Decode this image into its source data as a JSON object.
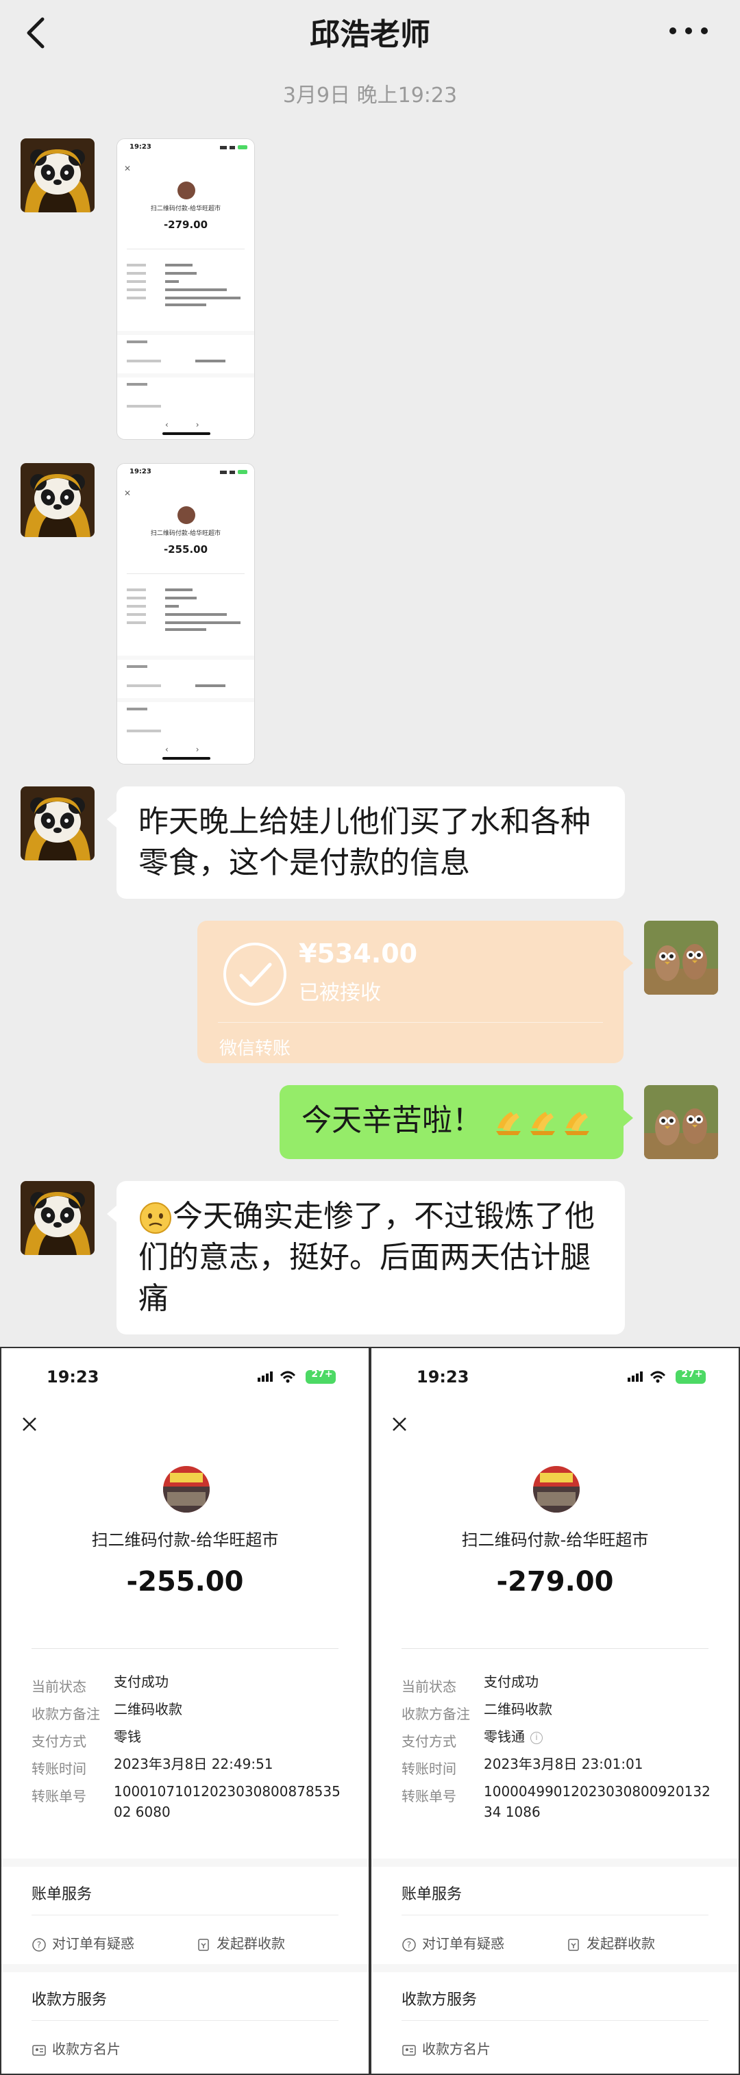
{
  "header": {
    "title": "邱浩老师"
  },
  "timestamp": "3月9日 晚上19:23",
  "messages": {
    "m1_text": "昨天晚上给娃儿他们买了水和各种零食，这个是付款的信息",
    "transfer": {
      "amount": "¥534.00",
      "status": "已被接收",
      "label": "微信转账"
    },
    "m2_text": "今天辛苦啦！",
    "m3_text": "今天确实走惨了，不过锻炼了他们的意志，挺好。后面两天估计腿痛"
  },
  "thumbnails": [
    {
      "time": "19:23",
      "merchant": "扫二维码付款-给华旺超市",
      "amount": "-279.00"
    },
    {
      "time": "19:23",
      "merchant": "扫二维码付款-给华旺超市",
      "amount": "-255.00"
    }
  ],
  "receipts": [
    {
      "time": "19:23",
      "battery": "27+",
      "merchant": "扫二维码付款-给华旺超市",
      "amount": "-255.00",
      "rows": [
        {
          "label": "当前状态",
          "value": "支付成功"
        },
        {
          "label": "收款方备注",
          "value": "二维码收款"
        },
        {
          "label": "支付方式",
          "value": "零钱"
        },
        {
          "label": "转账时间",
          "value": "2023年3月8日 22:49:51"
        },
        {
          "label": "转账单号",
          "value": "1000107101202303080087853502 6080"
        }
      ],
      "sec1_title": "账单服务",
      "action_doubt": "对订单有疑惑",
      "action_group": "发起群收款",
      "sec2_title": "收款方服务",
      "action_card": "收款方名片"
    },
    {
      "time": "19:23",
      "battery": "27+",
      "merchant": "扫二维码付款-给华旺超市",
      "amount": "-279.00",
      "rows": [
        {
          "label": "当前状态",
          "value": "支付成功"
        },
        {
          "label": "收款方备注",
          "value": "二维码收款"
        },
        {
          "label": "支付方式",
          "value": "零钱通"
        },
        {
          "label": "转账时间",
          "value": "2023年3月8日 23:01:01"
        },
        {
          "label": "转账单号",
          "value": "1000049901202303080092013234 1086"
        }
      ],
      "sec1_title": "账单服务",
      "action_doubt": "对订单有疑惑",
      "action_group": "发起群收款",
      "sec2_title": "收款方服务",
      "action_card": "收款方名片"
    }
  ],
  "colors": {
    "background": "#ededed",
    "sent_bubble": "#95ec69",
    "transfer_bubble": "#fbe0c4",
    "battery_green": "#4cd964"
  },
  "icons": [
    "back-arrow-icon",
    "more-icon",
    "panda-avatar",
    "owl-avatar",
    "check-circle-icon",
    "clapping-hands-emoji",
    "sad-face-emoji",
    "close-icon",
    "info-icon",
    "question-icon",
    "group-receipt-icon",
    "card-icon"
  ]
}
